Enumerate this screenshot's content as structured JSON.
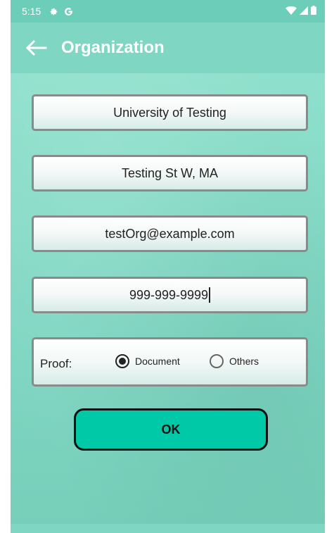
{
  "status_bar": {
    "time": "5:15",
    "icons": [
      "gear-icon",
      "google-icon",
      "wifi-icon",
      "signal-icon",
      "battery-icon"
    ]
  },
  "app_bar": {
    "title": "Organization",
    "back_icon": "back-arrow-icon"
  },
  "form": {
    "name": "University of Testing",
    "address": "Testing St W, MA",
    "email": "testOrg@example.com",
    "phone": "999-999-9999",
    "proof": {
      "label": "Proof:",
      "options": [
        {
          "label": "Document",
          "selected": true
        },
        {
          "label": "Others",
          "selected": false
        }
      ]
    }
  },
  "ok_button": {
    "label": "OK"
  },
  "colors": {
    "background": "#7fd6c2",
    "accent": "#00c9a7",
    "field_border": "#8a8a8a",
    "text": "#222222"
  }
}
